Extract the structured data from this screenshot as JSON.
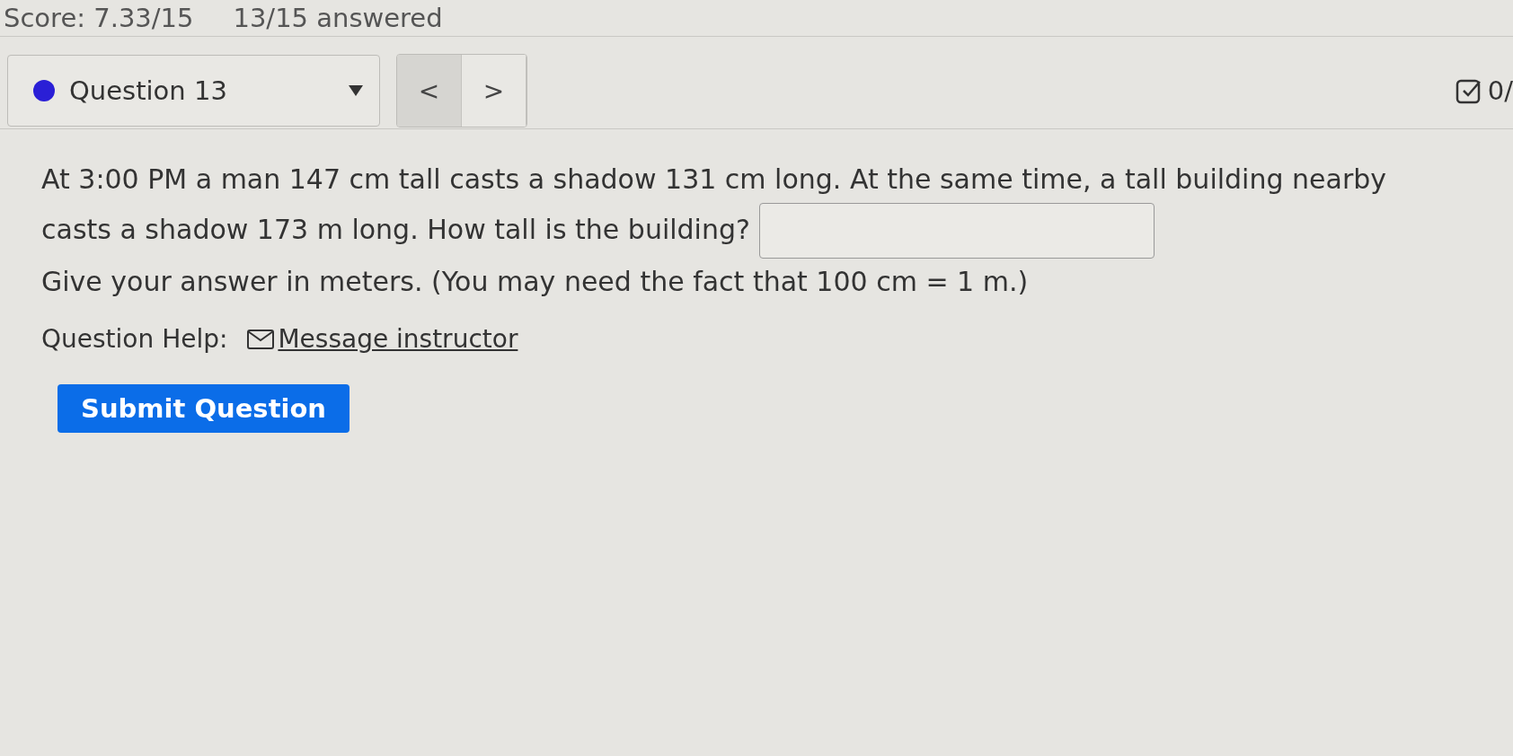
{
  "header": {
    "score": "Score: 7.33/15",
    "answered": "13/15 answered"
  },
  "question_nav": {
    "label": "Question 13",
    "color": "#2a1fd6",
    "prev": "<",
    "next": ">",
    "prev_selected": true
  },
  "points": "0/",
  "question": {
    "text": "At 3:00 PM a man 147 cm tall casts a shadow 131 cm long. At the same time, a tall building nearby casts a shadow 173 m long. How tall is the building?",
    "note": "Give your answer in meters. (You may need the fact that 100 cm = 1 m.)"
  },
  "help": {
    "label": "Question Help:",
    "link": "Message instructor"
  },
  "submit": "Submit Question"
}
